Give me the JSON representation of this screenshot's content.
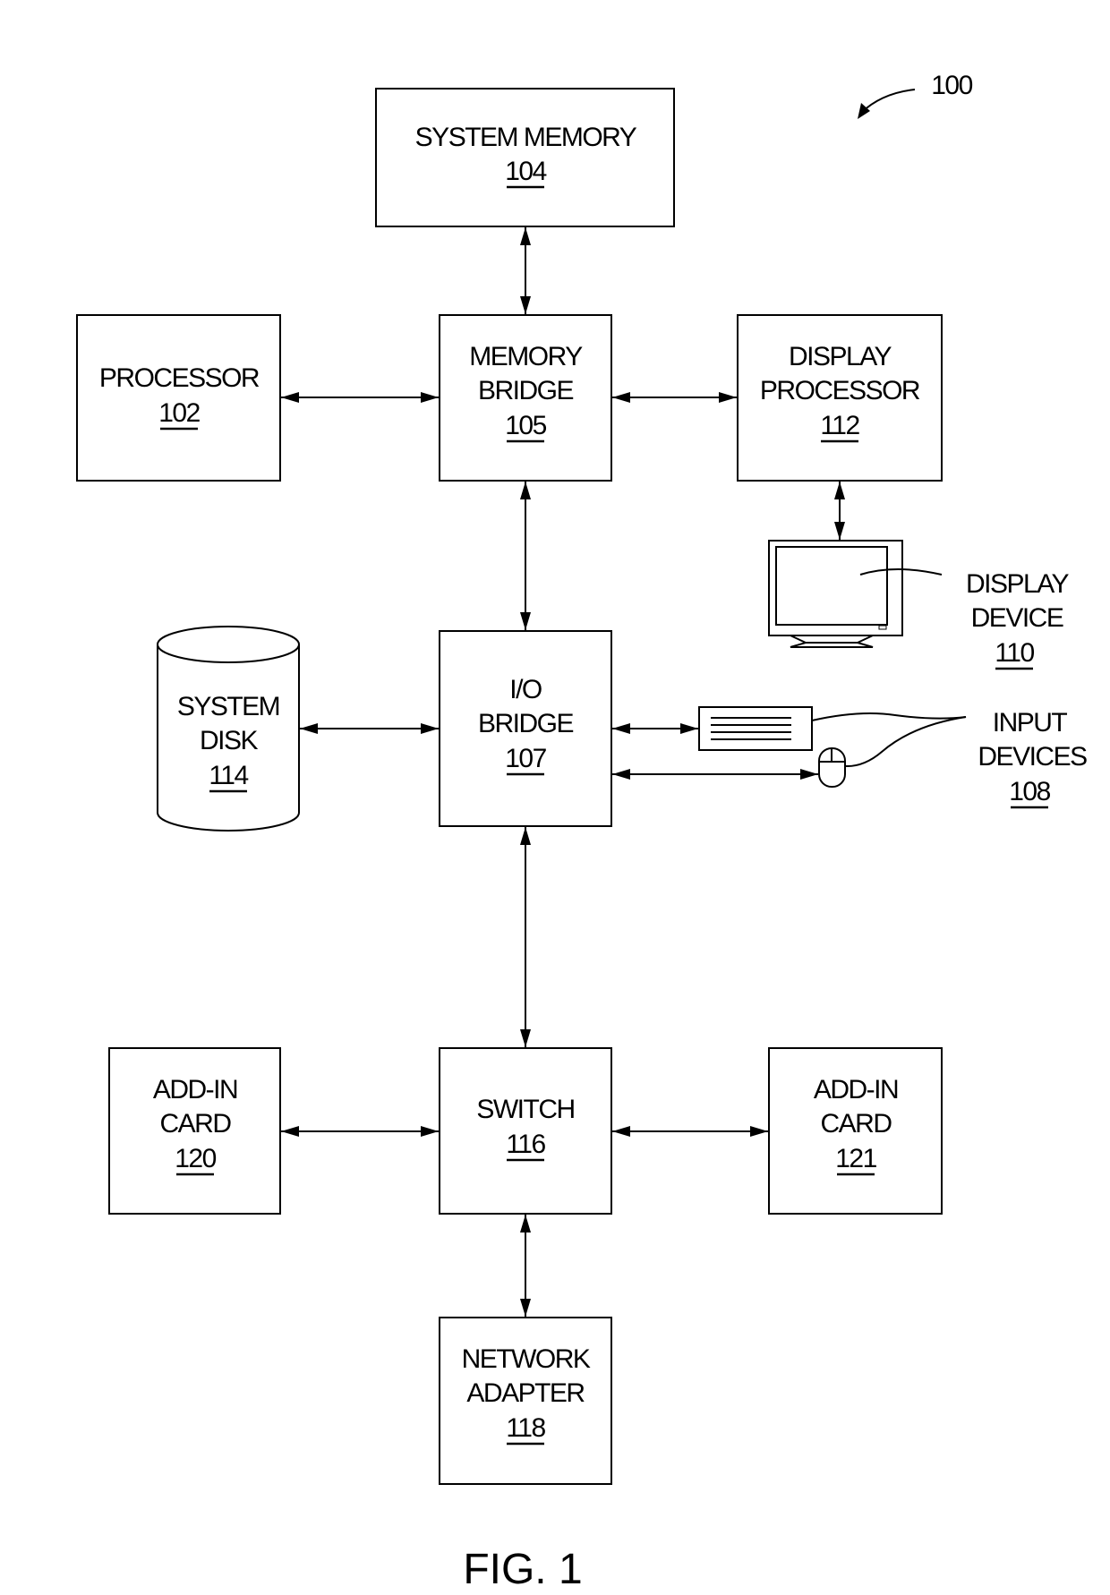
{
  "figure": {
    "reference": "100",
    "caption": "FIG. 1"
  },
  "components": {
    "system_memory": {
      "lines": [
        "SYSTEM MEMORY"
      ],
      "ref": "104"
    },
    "processor": {
      "lines": [
        "PROCESSOR"
      ],
      "ref": "102"
    },
    "memory_bridge": {
      "lines": [
        "MEMORY",
        "BRIDGE"
      ],
      "ref": "105"
    },
    "display_processor": {
      "lines": [
        "DISPLAY",
        "PROCESSOR"
      ],
      "ref": "112"
    },
    "display_device": {
      "lines": [
        "DISPLAY",
        "DEVICE"
      ],
      "ref": "110"
    },
    "system_disk": {
      "lines": [
        "SYSTEM",
        "DISK"
      ],
      "ref": "114"
    },
    "io_bridge": {
      "lines": [
        "I/O",
        "BRIDGE"
      ],
      "ref": "107"
    },
    "input_devices": {
      "lines": [
        "INPUT",
        "DEVICES"
      ],
      "ref": "108"
    },
    "add_in_card_120": {
      "lines": [
        "ADD-IN",
        "CARD"
      ],
      "ref": "120"
    },
    "switch": {
      "lines": [
        "SWITCH"
      ],
      "ref": "116"
    },
    "add_in_card_121": {
      "lines": [
        "ADD-IN",
        "CARD"
      ],
      "ref": "121"
    },
    "network_adapter": {
      "lines": [
        "NETWORK",
        "ADAPTER"
      ],
      "ref": "118"
    }
  },
  "connections": [
    [
      "system_memory",
      "memory_bridge"
    ],
    [
      "processor",
      "memory_bridge"
    ],
    [
      "memory_bridge",
      "display_processor"
    ],
    [
      "display_processor",
      "display_device"
    ],
    [
      "memory_bridge",
      "io_bridge"
    ],
    [
      "system_disk",
      "io_bridge"
    ],
    [
      "io_bridge",
      "input_devices"
    ],
    [
      "io_bridge",
      "switch"
    ],
    [
      "add_in_card_120",
      "switch"
    ],
    [
      "switch",
      "add_in_card_121"
    ],
    [
      "switch",
      "network_adapter"
    ]
  ]
}
